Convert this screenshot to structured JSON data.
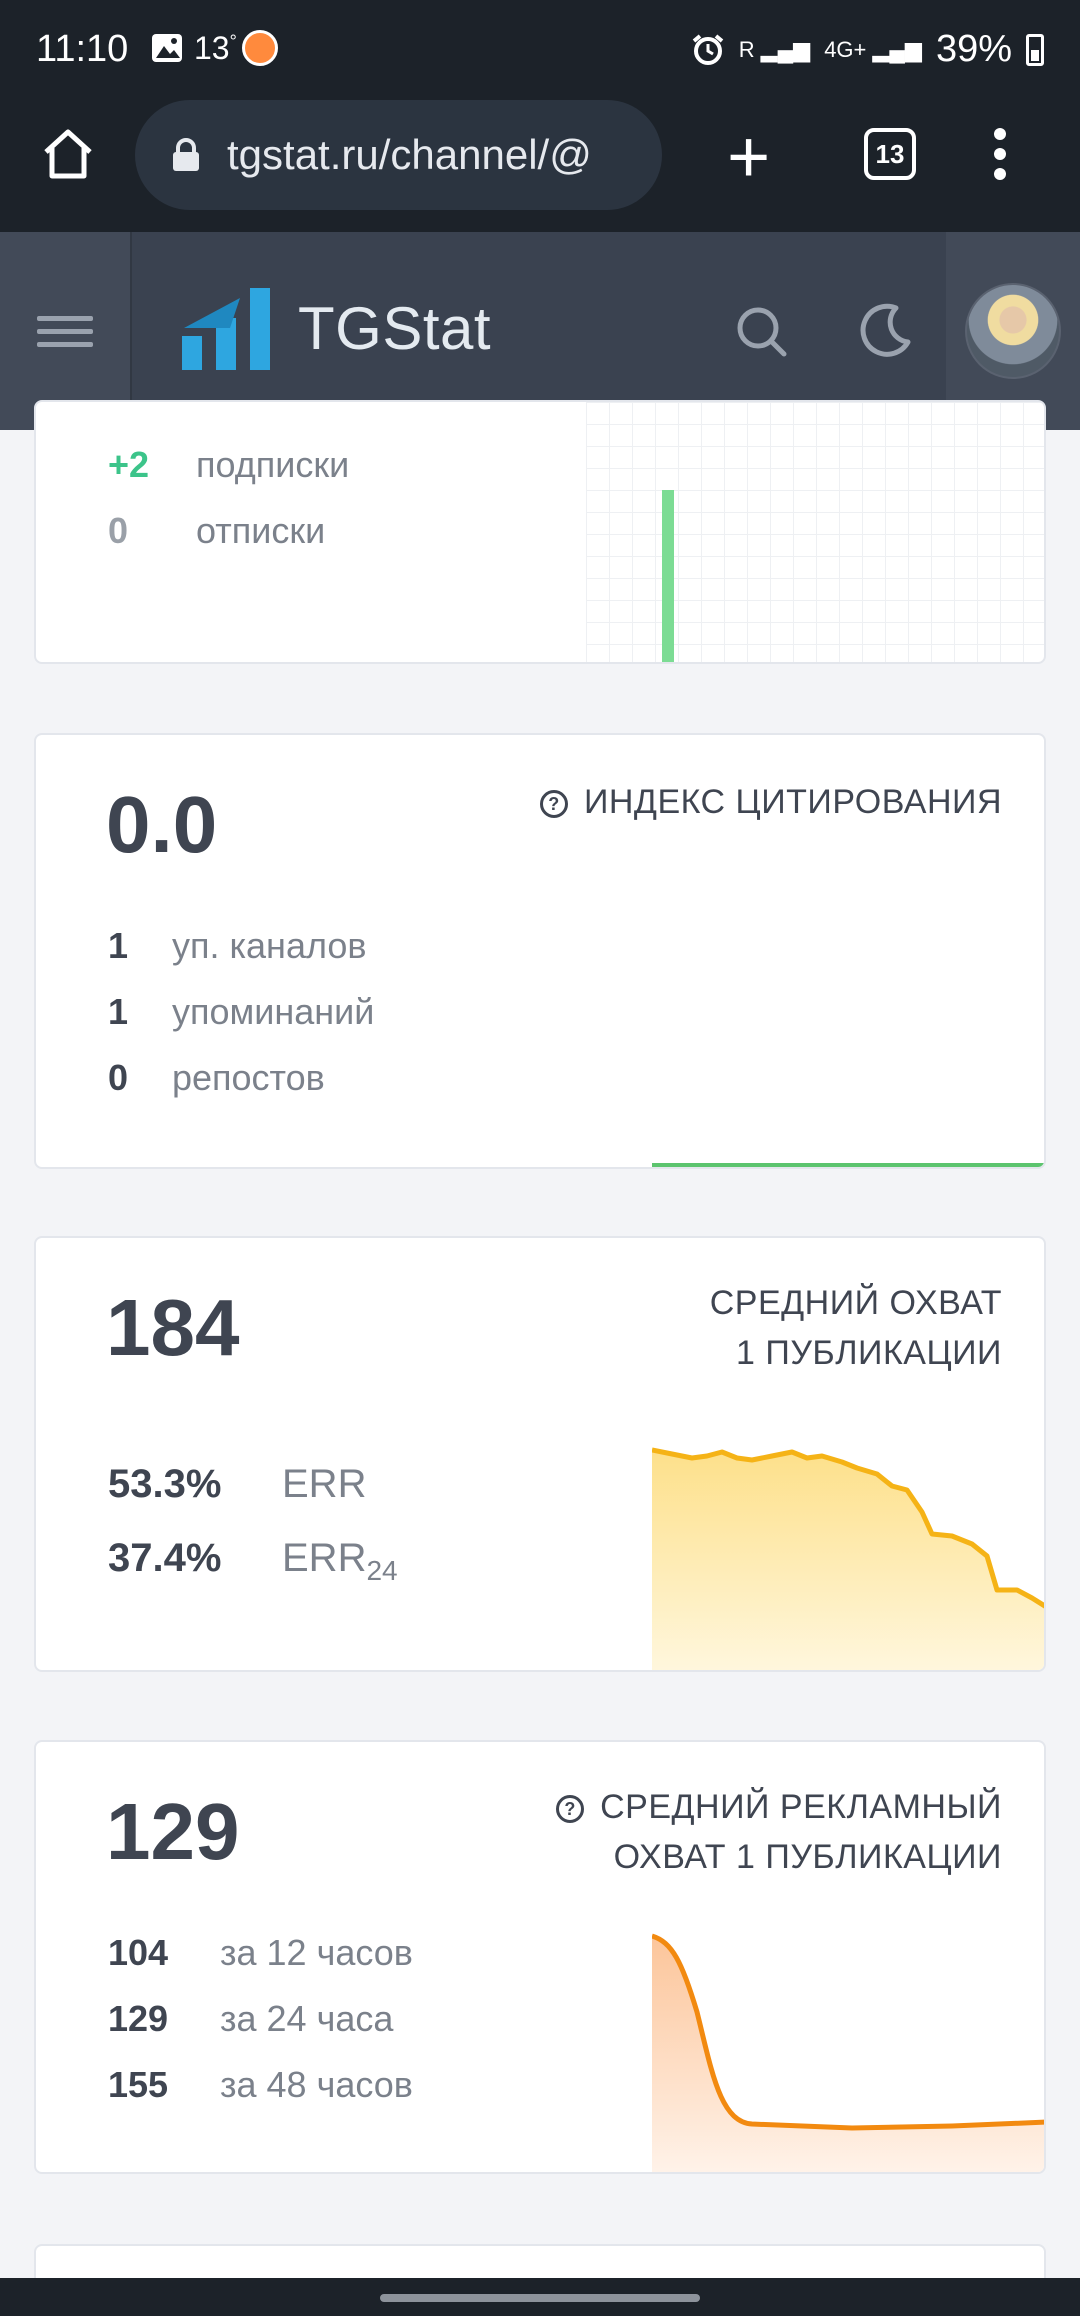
{
  "status_bar": {
    "time": "11:10",
    "temperature": "13",
    "degree": "°",
    "network_r": "R",
    "network_4g": "4G+",
    "battery": "39%"
  },
  "browser": {
    "url": "tgstat.ru/channel/@",
    "tab_count": "13"
  },
  "header": {
    "brand": "TGStat"
  },
  "subscriptions_card": {
    "rows": [
      {
        "value": "+2",
        "label": "подписки"
      },
      {
        "value": "0",
        "label": "отписки"
      }
    ]
  },
  "citation_card": {
    "value": "0.0",
    "title": "ИНДЕКС ЦИТИРОВАНИЯ",
    "rows": [
      {
        "value": "1",
        "label": "уп. каналов"
      },
      {
        "value": "1",
        "label": "упоминаний"
      },
      {
        "value": "0",
        "label": "репостов"
      }
    ]
  },
  "reach_card": {
    "value": "184",
    "title_line1": "СРЕДНИЙ ОХВАТ",
    "title_line2": "1 ПУБЛИКАЦИИ",
    "rows": [
      {
        "value": "53.3%",
        "label": "ERR",
        "sub": ""
      },
      {
        "value": "37.4%",
        "label": "ERR",
        "sub": "24"
      }
    ],
    "chart_color": "#f5b316"
  },
  "ad_reach_card": {
    "value": "129",
    "title_line1": "СРЕДНИЙ РЕКЛАМНЫЙ",
    "title_line2": "ОХВАТ 1 ПУБЛИКАЦИИ",
    "rows": [
      {
        "value": "104",
        "label": "за 12 часов"
      },
      {
        "value": "129",
        "label": "за 24 часа"
      },
      {
        "value": "155",
        "label": "за 48 часов"
      }
    ],
    "chart_color": "#f28a10"
  },
  "colors": {
    "header_bg": "#3a4250",
    "accent_green": "#3cc48a",
    "logo_blue": "#2ea6e0"
  }
}
